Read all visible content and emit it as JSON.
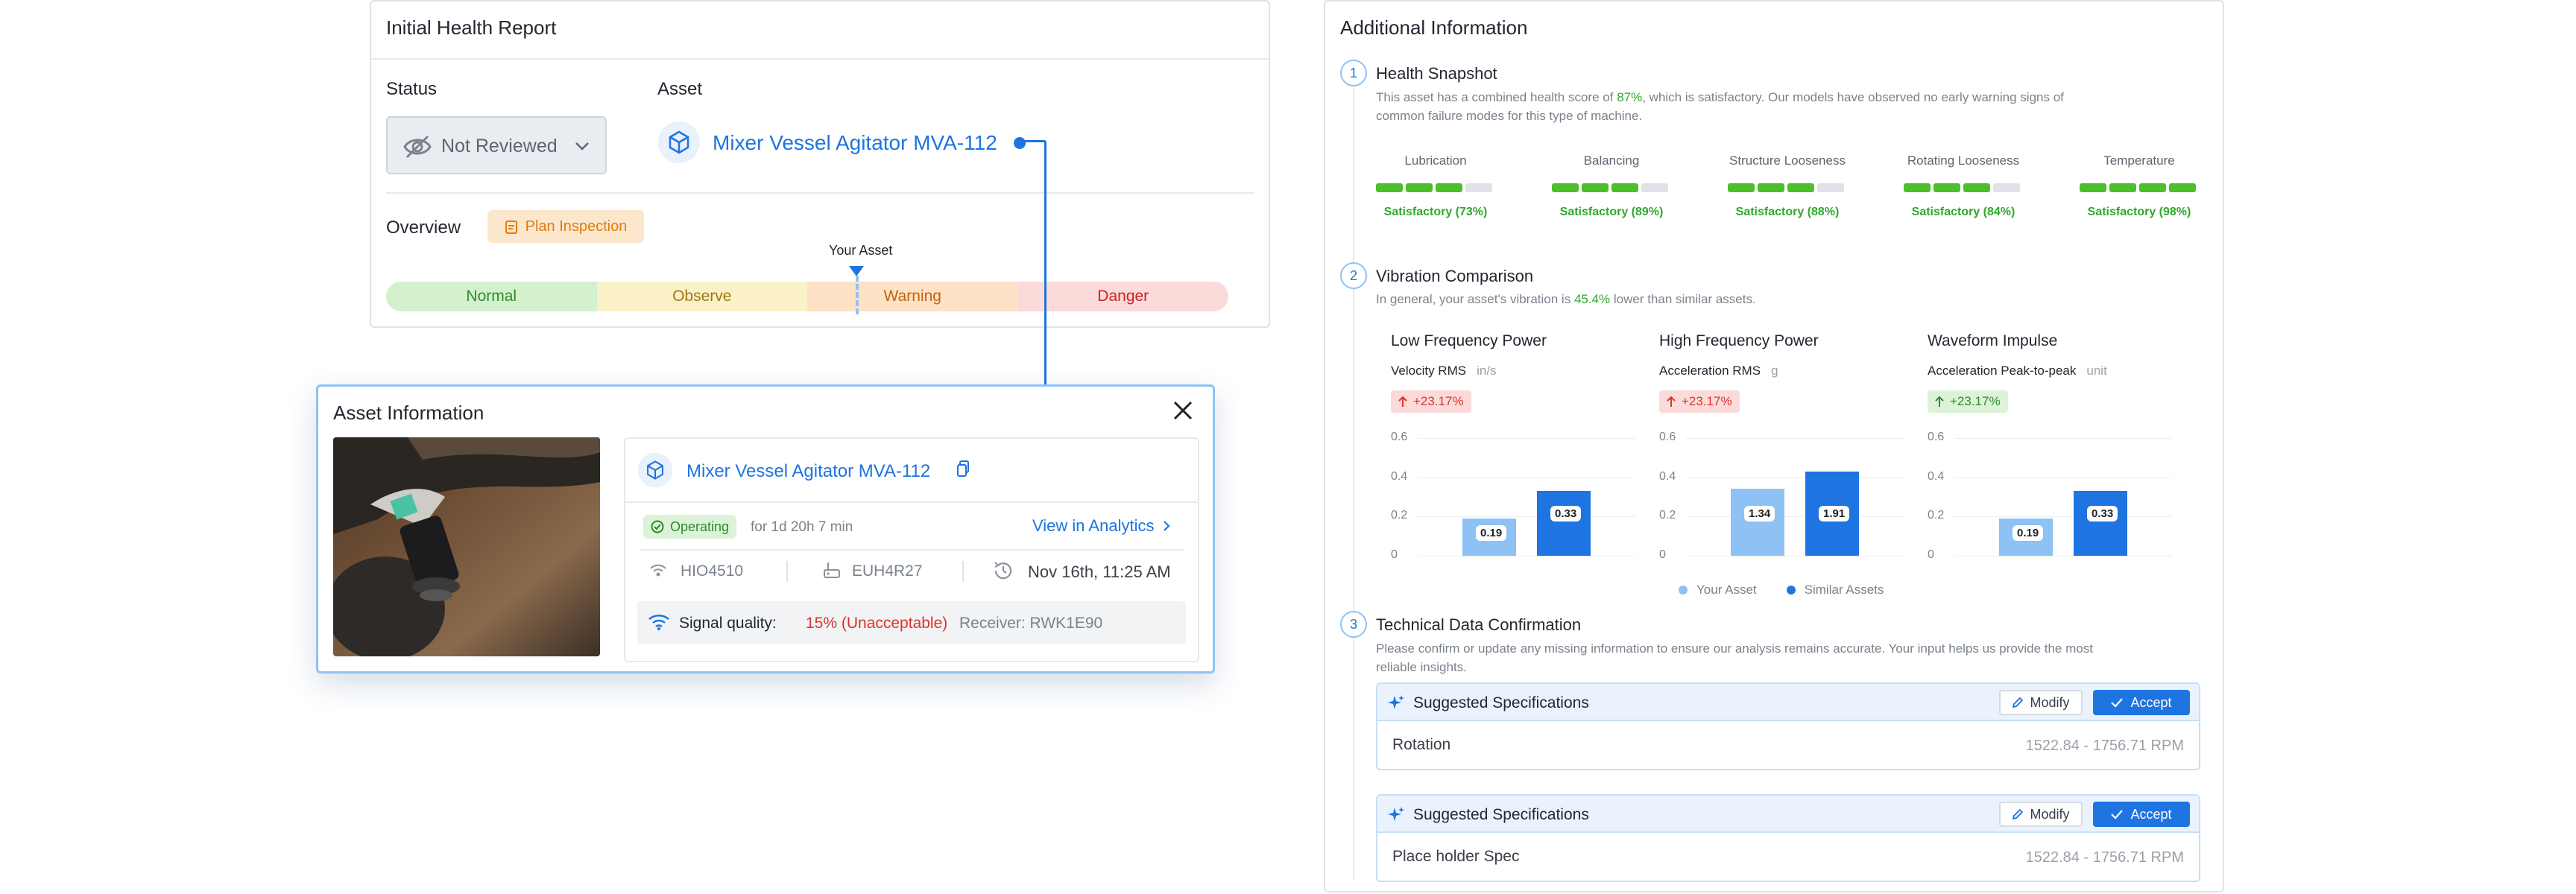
{
  "report": {
    "title": "Initial Health Report",
    "status_label": "Status",
    "status_value": "Not Reviewed",
    "asset_label": "Asset",
    "asset_name": "Mixer Vessel Agitator MVA-112",
    "overview_label": "Overview",
    "plan_button": "Plan Inspection",
    "your_asset_marker": "Your Asset",
    "scale": [
      "Normal",
      "Observe",
      "Warning",
      "Danger"
    ]
  },
  "asset_info": {
    "title": "Asset Information",
    "asset_name": "Mixer Vessel Agitator MVA-112",
    "status_badge": "Operating",
    "duration": "for 1d 20h 7 min",
    "analytics_link": "View in Analytics",
    "sensor_id": "HIO4510",
    "gateway_id": "EUH4R27",
    "timestamp": "Nov 16th, 11:25 AM",
    "signal_label": "Signal quality:",
    "signal_value": "15% (Unacceptable)",
    "receiver": "Receiver: RWK1E90"
  },
  "additional": {
    "title": "Additional Information",
    "steps": [
      "1",
      "2",
      "3"
    ],
    "snapshot": {
      "title": "Health Snapshot",
      "desc_pre": "This asset has a combined health score of ",
      "score": "87%",
      "desc_post": ", which is satisfactory. Our models have observed no early warning signs of",
      "desc_line2": "common failure modes for this type of machine.",
      "metrics": [
        {
          "label": "Lubrication",
          "status": "Satisfactory (73%)",
          "filled": 3
        },
        {
          "label": "Balancing",
          "status": "Satisfactory (89%)",
          "filled": 3
        },
        {
          "label": "Structure Looseness",
          "status": "Satisfactory (88%)",
          "filled": 3
        },
        {
          "label": "Rotating Looseness",
          "status": "Satisfactory (84%)",
          "filled": 3
        },
        {
          "label": "Temperature",
          "status": "Satisfactory (98%)",
          "filled": 4
        }
      ]
    },
    "vibration": {
      "title": "Vibration Comparison",
      "desc_pre": "In general, your asset's vibration is ",
      "pct": "45.4%",
      "desc_post": " lower than similar assets.",
      "legend_yours": "Your Asset",
      "legend_similar": "Similar Assets",
      "colors": {
        "yours": "#8ec2f5",
        "similar": "#1e74e0"
      }
    },
    "tech": {
      "title": "Technical Data Confirmation",
      "desc_line1": "Please confirm or update any missing information to ensure our analysis remains accurate. Your input helps us provide the most",
      "desc_line2": "reliable insights.",
      "cards": [
        {
          "title": "Suggested Specifications",
          "modify": "Modify",
          "accept": "Accept",
          "spec_name": "Rotation",
          "spec_value": "1522.84 - 1756.71 RPM"
        },
        {
          "title": "Suggested Specifications",
          "modify": "Modify",
          "accept": "Accept",
          "spec_name": "Place holder Spec",
          "spec_value": "1522.84 - 1756.71 RPM"
        }
      ]
    }
  },
  "chart_data": [
    {
      "type": "bar",
      "title": "Low Frequency Power",
      "ylabel": "Velocity RMS",
      "unit": "in/s",
      "change": "+23.17%",
      "change_dir": "up-bad",
      "categories": [
        ""
      ],
      "series": [
        {
          "name": "Your Asset",
          "values": [
            0.19
          ]
        },
        {
          "name": "Similar Assets",
          "values": [
            0.33
          ]
        }
      ],
      "ylim": [
        0,
        0.6
      ],
      "yticks": [
        "0",
        "0.2",
        "0.4",
        "0.6"
      ],
      "value_labels": [
        "0.19",
        "0.33"
      ]
    },
    {
      "type": "bar",
      "title": "High Frequency Power",
      "ylabel": "Acceleration RMS",
      "unit": "g",
      "change": "+23.17%",
      "change_dir": "up-bad",
      "categories": [
        ""
      ],
      "series": [
        {
          "name": "Your Asset",
          "values": [
            0.34
          ]
        },
        {
          "name": "Similar Assets",
          "values": [
            0.43
          ]
        }
      ],
      "ylim": [
        0,
        0.6
      ],
      "yticks": [
        "0",
        "0.2",
        "0.4",
        "0.6"
      ],
      "value_labels": [
        "1.34",
        "1.91"
      ]
    },
    {
      "type": "bar",
      "title": "Waveform Impulse",
      "ylabel": "Acceleration Peak-to-peak",
      "unit": "unit",
      "change": "+23.17%",
      "change_dir": "up-good",
      "categories": [
        ""
      ],
      "series": [
        {
          "name": "Your Asset",
          "values": [
            0.19
          ]
        },
        {
          "name": "Similar Assets",
          "values": [
            0.33
          ]
        }
      ],
      "ylim": [
        0,
        0.6
      ],
      "yticks": [
        "0",
        "0.2",
        "0.4",
        "0.6"
      ],
      "value_labels": [
        "0.19",
        "0.33"
      ]
    }
  ]
}
